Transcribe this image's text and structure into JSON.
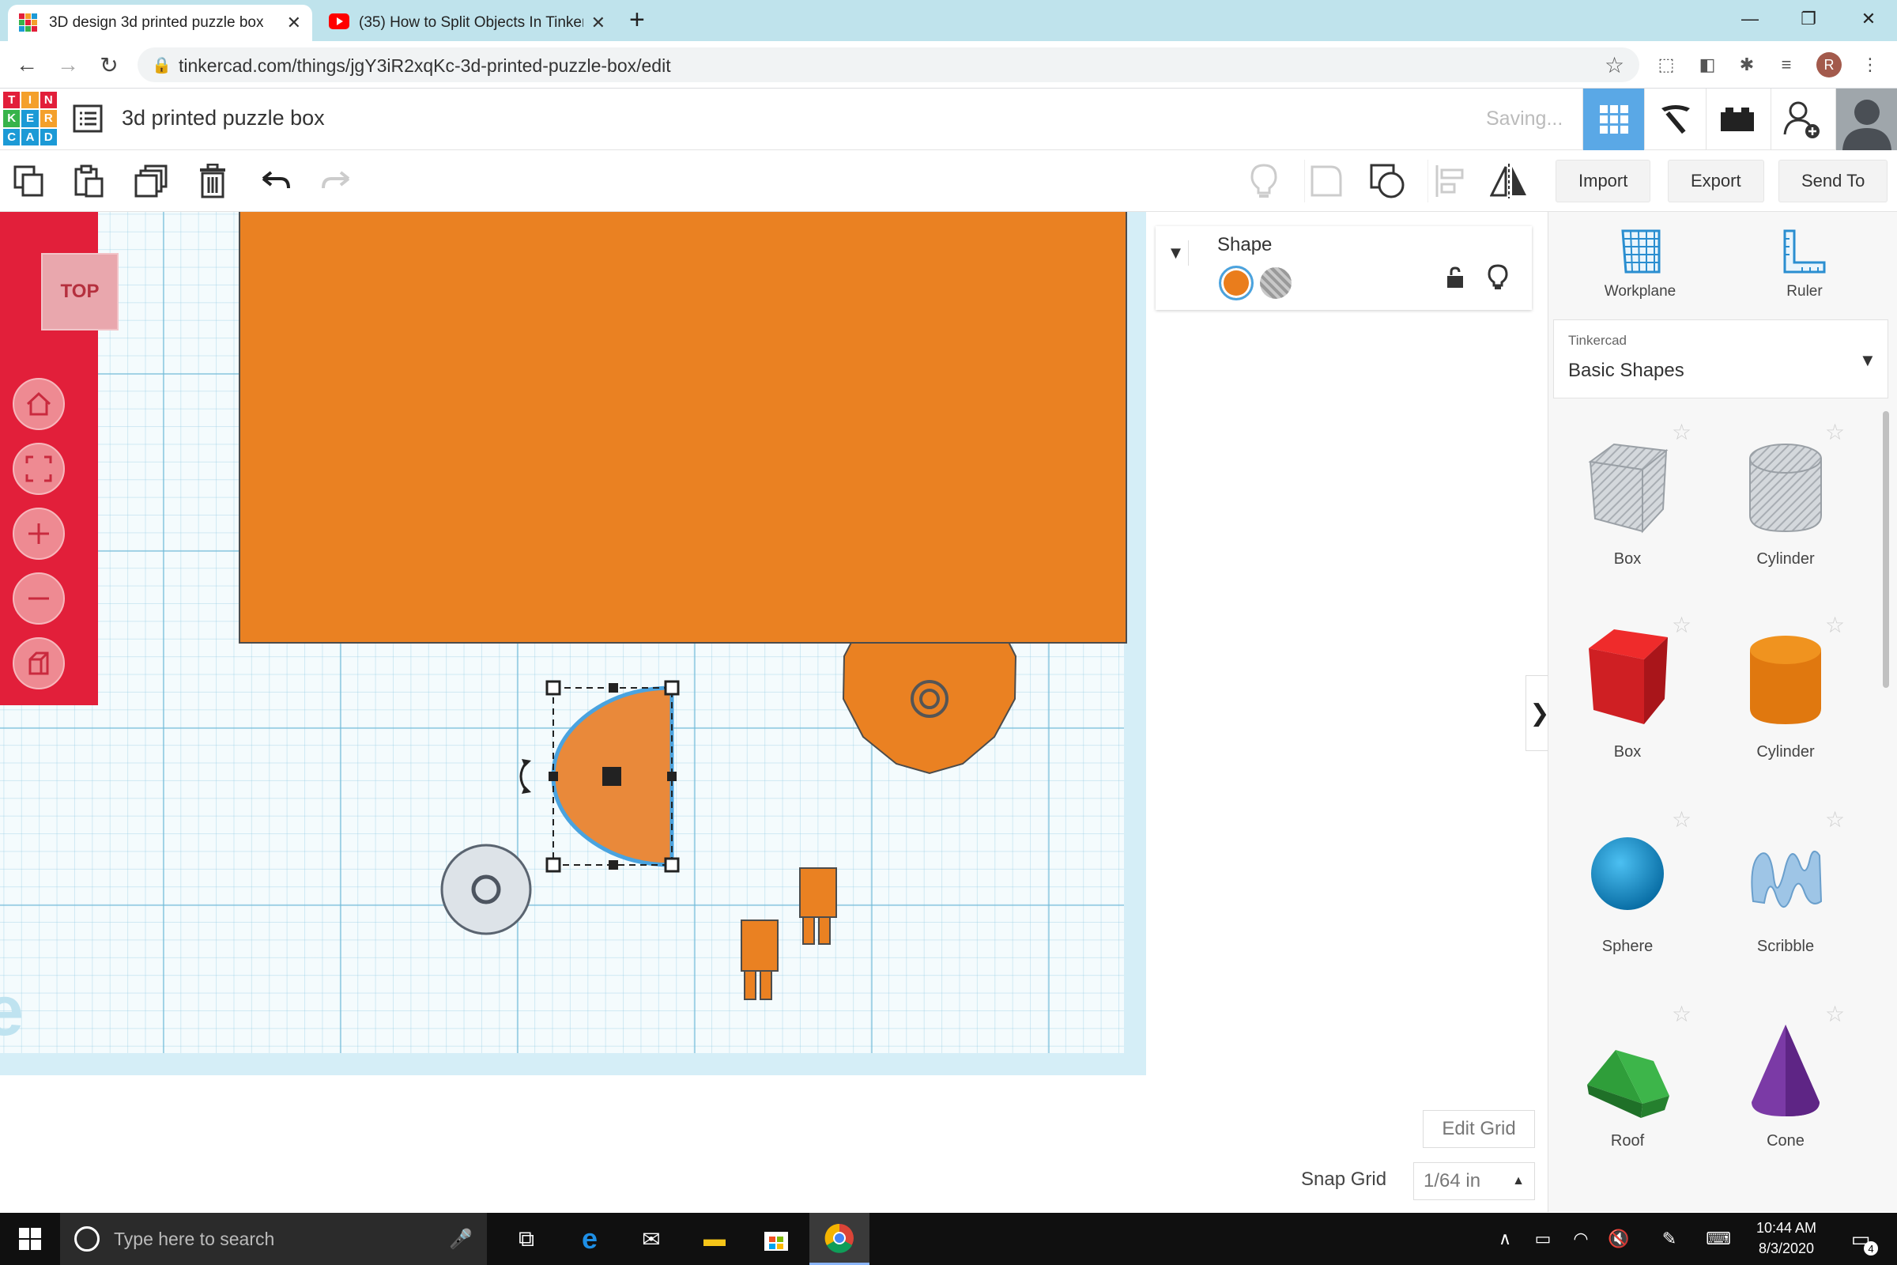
{
  "browser": {
    "tabs": [
      {
        "title": "3D design 3d printed puzzle box"
      },
      {
        "title": "(35) How to Split Objects In Tinkercad"
      }
    ],
    "url": "tinkercad.com/things/jgY3iR2xqKc-3d-printed-puzzle-box/edit",
    "new_tab": "+",
    "profile_initial": "R"
  },
  "logo": [
    "T",
    "I",
    "N",
    "K",
    "E",
    "R",
    "C",
    "A",
    "D"
  ],
  "header": {
    "design_title": "3d printed puzzle box",
    "status": "Saving..."
  },
  "toolbar": {
    "import_label": "Import",
    "export_label": "Export",
    "sendto_label": "Send To"
  },
  "viewcube": {
    "label": "TOP"
  },
  "inspector": {
    "title": "Shape",
    "solid_color": "#ea7d1c"
  },
  "right_panel": {
    "workplane_label": "Workplane",
    "ruler_label": "Ruler",
    "library_sub": "Tinkercad",
    "library_main": "Basic Shapes",
    "shapes": [
      {
        "label": "Box",
        "icon": "box-hole-icon"
      },
      {
        "label": "Cylinder",
        "icon": "cylinder-hole-icon"
      },
      {
        "label": "Box",
        "icon": "box-red-icon"
      },
      {
        "label": "Cylinder",
        "icon": "cylinder-orange-icon"
      },
      {
        "label": "Sphere",
        "icon": "sphere-icon"
      },
      {
        "label": "Scribble",
        "icon": "scribble-icon"
      },
      {
        "label": "Roof",
        "icon": "roof-icon"
      },
      {
        "label": "Cone",
        "icon": "cone-icon"
      }
    ]
  },
  "grid_controls": {
    "edit_grid": "Edit Grid",
    "snap_label": "Snap Grid",
    "snap_value": "1/64 in"
  },
  "taskbar": {
    "search_placeholder": "Type here to search",
    "time": "10:44 AM",
    "date": "8/3/2020",
    "notification_count": "4"
  },
  "colors": {
    "tinkercad_red": "#e21f3a",
    "shape_orange": "#ea8122",
    "selection_blue": "#4aa3df",
    "header_active_blue": "#5aa8e6"
  }
}
